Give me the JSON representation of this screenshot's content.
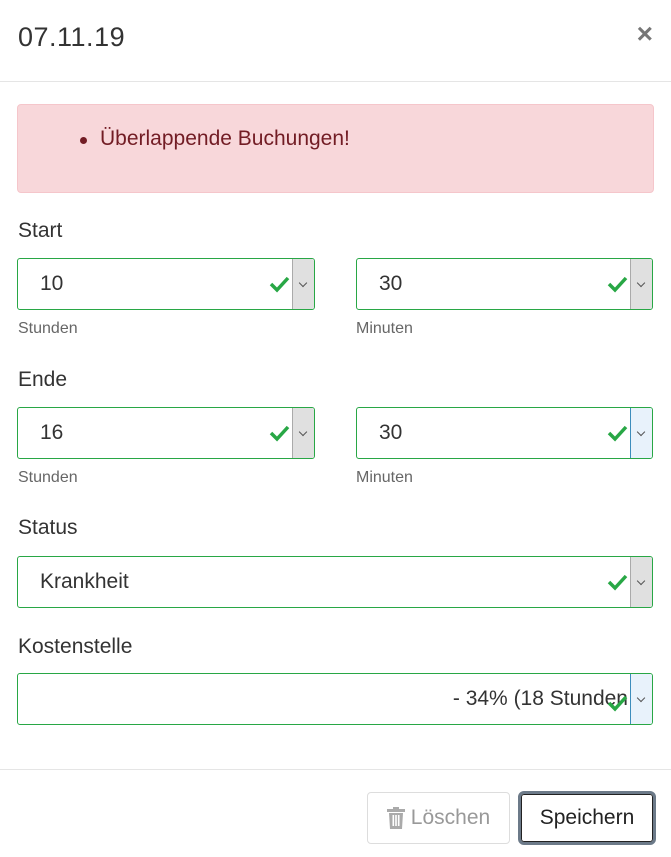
{
  "header": {
    "title": "07.11.19",
    "close_symbol": "×"
  },
  "alert": {
    "items": [
      "Überlappende Buchungen!"
    ]
  },
  "start": {
    "label": "Start",
    "hours": {
      "value": "10",
      "help": "Stunden"
    },
    "minutes": {
      "value": "30",
      "help": "Minuten"
    }
  },
  "end": {
    "label": "Ende",
    "hours": {
      "value": "16",
      "help": "Stunden"
    },
    "minutes": {
      "value": "30",
      "help": "Minuten"
    }
  },
  "status": {
    "label": "Status",
    "value": "Krankheit"
  },
  "cost_center": {
    "label": "Kostenstelle",
    "value": "- 34% (18 Stunden"
  },
  "footer": {
    "delete_label": "Löschen",
    "save_label": "Speichern"
  },
  "colors": {
    "valid": "#28a745",
    "alert_bg": "#f8d7da",
    "alert_text": "#721c24"
  },
  "icons": {
    "valid": "check-icon",
    "dropdown": "chevron-down-icon",
    "delete": "trash-icon",
    "close": "close-icon"
  }
}
